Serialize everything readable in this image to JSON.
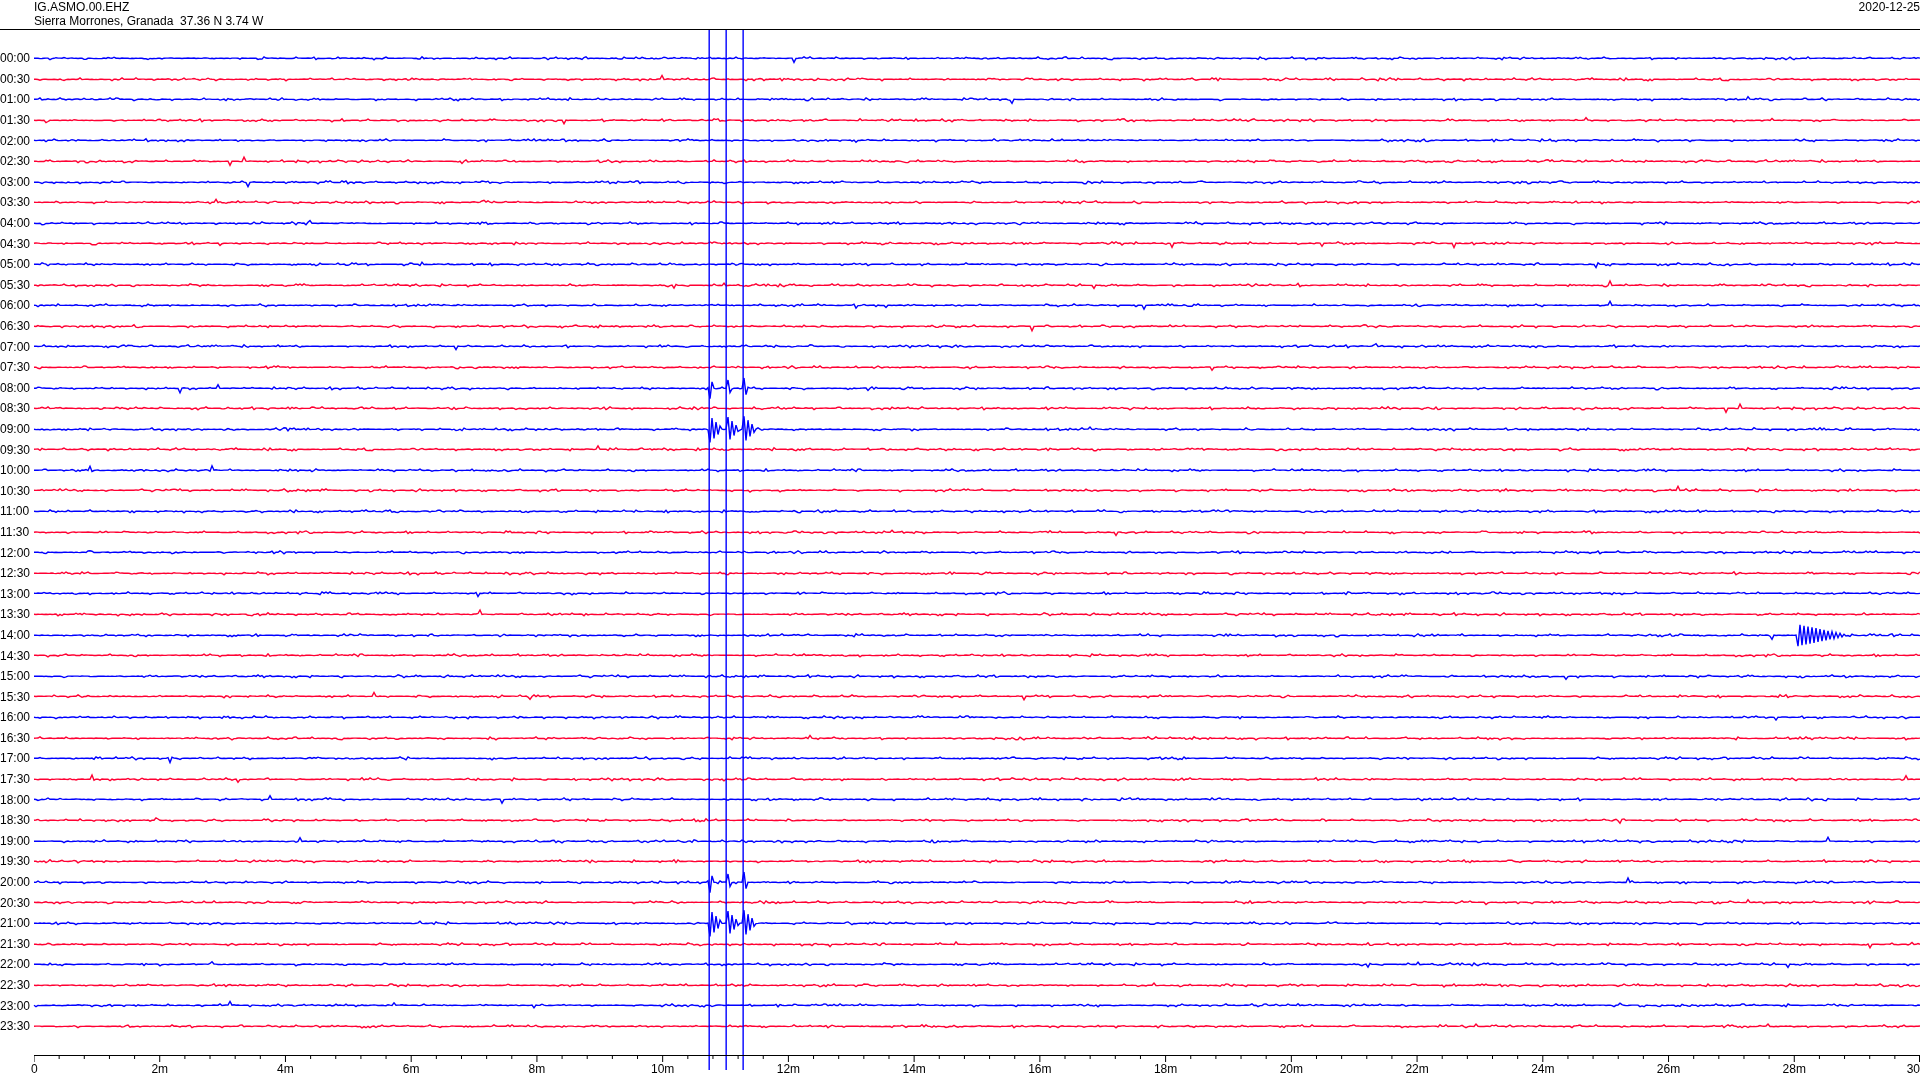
{
  "header": {
    "station": "IG.ASMO.00.EHZ",
    "location": "Sierra Morrones, Granada  37.36 N 3.74 W",
    "date": "2020-12-25"
  },
  "rows": [
    {
      "time": "00:00",
      "color": "#0000ff"
    },
    {
      "time": "00:30",
      "color": "#ff0033"
    },
    {
      "time": "01:00",
      "color": "#0000ff"
    },
    {
      "time": "01:30",
      "color": "#ff0033"
    },
    {
      "time": "02:00",
      "color": "#0000ff"
    },
    {
      "time": "02:30",
      "color": "#ff0033"
    },
    {
      "time": "03:00",
      "color": "#0000ff"
    },
    {
      "time": "03:30",
      "color": "#ff0033"
    },
    {
      "time": "04:00",
      "color": "#0000ff"
    },
    {
      "time": "04:30",
      "color": "#ff0033"
    },
    {
      "time": "05:00",
      "color": "#0000ff"
    },
    {
      "time": "05:30",
      "color": "#ff0033"
    },
    {
      "time": "06:00",
      "color": "#0000ff"
    },
    {
      "time": "06:30",
      "color": "#ff0033"
    },
    {
      "time": "07:00",
      "color": "#0000ff"
    },
    {
      "time": "07:30",
      "color": "#ff0033"
    },
    {
      "time": "08:00",
      "color": "#0000ff"
    },
    {
      "time": "08:30",
      "color": "#ff0033"
    },
    {
      "time": "09:00",
      "color": "#0000ff"
    },
    {
      "time": "09:30",
      "color": "#ff0033"
    },
    {
      "time": "10:00",
      "color": "#0000ff"
    },
    {
      "time": "10:30",
      "color": "#ff0033"
    },
    {
      "time": "11:00",
      "color": "#0000ff"
    },
    {
      "time": "11:30",
      "color": "#ff0033"
    },
    {
      "time": "12:00",
      "color": "#0000ff"
    },
    {
      "time": "12:30",
      "color": "#ff0033"
    },
    {
      "time": "13:00",
      "color": "#0000ff"
    },
    {
      "time": "13:30",
      "color": "#ff0033"
    },
    {
      "time": "14:00",
      "color": "#0000ff"
    },
    {
      "time": "14:30",
      "color": "#ff0033"
    },
    {
      "time": "15:00",
      "color": "#0000ff"
    },
    {
      "time": "15:30",
      "color": "#ff0033"
    },
    {
      "time": "16:00",
      "color": "#0000ff"
    },
    {
      "time": "16:30",
      "color": "#ff0033"
    },
    {
      "time": "17:00",
      "color": "#0000ff"
    },
    {
      "time": "17:30",
      "color": "#ff0033"
    },
    {
      "time": "18:00",
      "color": "#0000ff"
    },
    {
      "time": "18:30",
      "color": "#ff0033"
    },
    {
      "time": "19:00",
      "color": "#0000ff"
    },
    {
      "time": "19:30",
      "color": "#ff0033"
    },
    {
      "time": "20:00",
      "color": "#0000ff"
    },
    {
      "time": "20:30",
      "color": "#ff0033"
    },
    {
      "time": "21:00",
      "color": "#0000ff"
    },
    {
      "time": "21:30",
      "color": "#ff0033"
    },
    {
      "time": "22:00",
      "color": "#0000ff"
    },
    {
      "time": "22:30",
      "color": "#ff0033"
    },
    {
      "time": "23:00",
      "color": "#0000ff"
    },
    {
      "time": "23:30",
      "color": "#ff0033"
    }
  ],
  "x_axis": {
    "ticks": [
      "0",
      "2m",
      "4m",
      "6m",
      "8m",
      "10m",
      "12m",
      "14m",
      "16m",
      "18m",
      "20m",
      "22m",
      "24m",
      "26m",
      "28m",
      "30"
    ]
  }
}
